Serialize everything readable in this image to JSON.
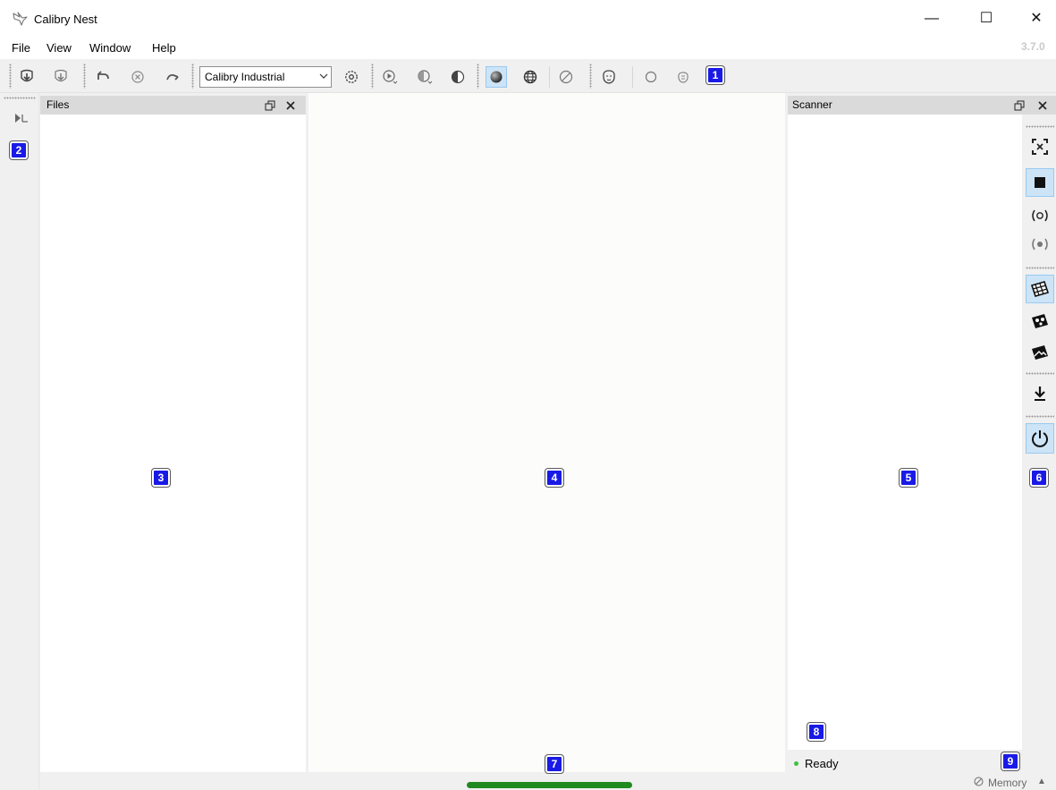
{
  "window": {
    "title": "Calibry Nest",
    "version": "3.7.0",
    "controls": {
      "minimize": "—",
      "maximize": "☐",
      "close": "✕"
    }
  },
  "menu": [
    "File",
    "View",
    "Window",
    "Help"
  ],
  "toolbar": {
    "groups": [
      [
        "open-project-icon",
        "import-icon"
      ],
      [
        "undo-icon",
        "cancel-icon",
        "redo-icon"
      ],
      [
        "settings-gear-icon"
      ],
      [
        "play-icon",
        "texture-icon",
        "shading-icon"
      ],
      [
        "solid-sphere-icon",
        "wireframe-globe-icon",
        "no-render-icon"
      ],
      [
        "head-model-icon",
        "circle-icon",
        "object-icon"
      ]
    ],
    "profile_select": {
      "value": "Calibry Industrial",
      "options": [
        "Calibry Industrial"
      ]
    },
    "active_tool": "solid-sphere-icon"
  },
  "panels": {
    "files": {
      "title": "Files"
    },
    "scanner": {
      "title": "Scanner",
      "status": "Ready",
      "tools": [
        "target-frame-icon",
        "stop-icon",
        "preview-icon",
        "record-icon",
        "texture-map-icon",
        "texture-photo-icon",
        "texture-image-icon",
        "download-icon",
        "power-icon"
      ],
      "active_tools": [
        "stop-icon",
        "texture-map-icon",
        "power-icon"
      ]
    }
  },
  "left_strip": {
    "tools": [
      "fast-forward-icon"
    ]
  },
  "status": {
    "memory_label": "Memory",
    "progress": 1.0
  },
  "annotations": [
    "1",
    "2",
    "3",
    "4",
    "5",
    "6",
    "7",
    "8",
    "9"
  ],
  "colors": {
    "accent_active": "#cde4f7",
    "badge": "#1a1ae6",
    "progress": "#1f8a1f",
    "ready_dot": "#3fbf3f"
  }
}
